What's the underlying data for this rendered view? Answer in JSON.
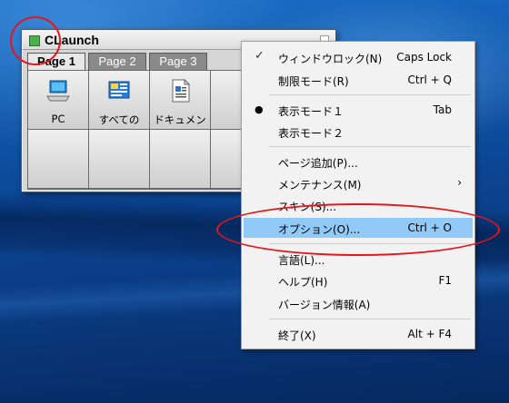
{
  "window": {
    "title": "CLaunch",
    "tabs": [
      "Page 1",
      "Page 2",
      "Page 3"
    ],
    "items": [
      {
        "label": "PC",
        "icon": "computer-icon"
      },
      {
        "label": "すべての",
        "icon": "control-panel-icon"
      },
      {
        "label": "ドキュメン",
        "icon": "document-icon"
      }
    ]
  },
  "menu": {
    "items": [
      {
        "label": "ウィンドウロック(N)",
        "shortcut": "Caps Lock",
        "mark": "✓"
      },
      {
        "label": "制限モード(R)",
        "shortcut": "Ctrl + Q",
        "mark": ""
      },
      {
        "label": "表示モード１",
        "shortcut": "Tab",
        "mark": "●"
      },
      {
        "label": "表示モード２",
        "shortcut": "",
        "mark": ""
      },
      {
        "label": "ページ追加(P)...",
        "shortcut": "",
        "mark": ""
      },
      {
        "label": "メンテナンス(M)",
        "shortcut": "›",
        "mark": ""
      },
      {
        "label": "スキン(S)...",
        "shortcut": "",
        "mark": ""
      },
      {
        "label": "オプション(O)...",
        "shortcut": "Ctrl + O",
        "mark": ""
      },
      {
        "label": "言語(L)...",
        "shortcut": "",
        "mark": ""
      },
      {
        "label": "ヘルプ(H)",
        "shortcut": "F1",
        "mark": ""
      },
      {
        "label": "バージョン情報(A)",
        "shortcut": "",
        "mark": ""
      },
      {
        "label": "終了(X)",
        "shortcut": "Alt + F4",
        "mark": ""
      }
    ]
  },
  "colors": {
    "highlight": "#91c9f7",
    "annotation": "#e4161d",
    "logo": "#4bb14b"
  }
}
